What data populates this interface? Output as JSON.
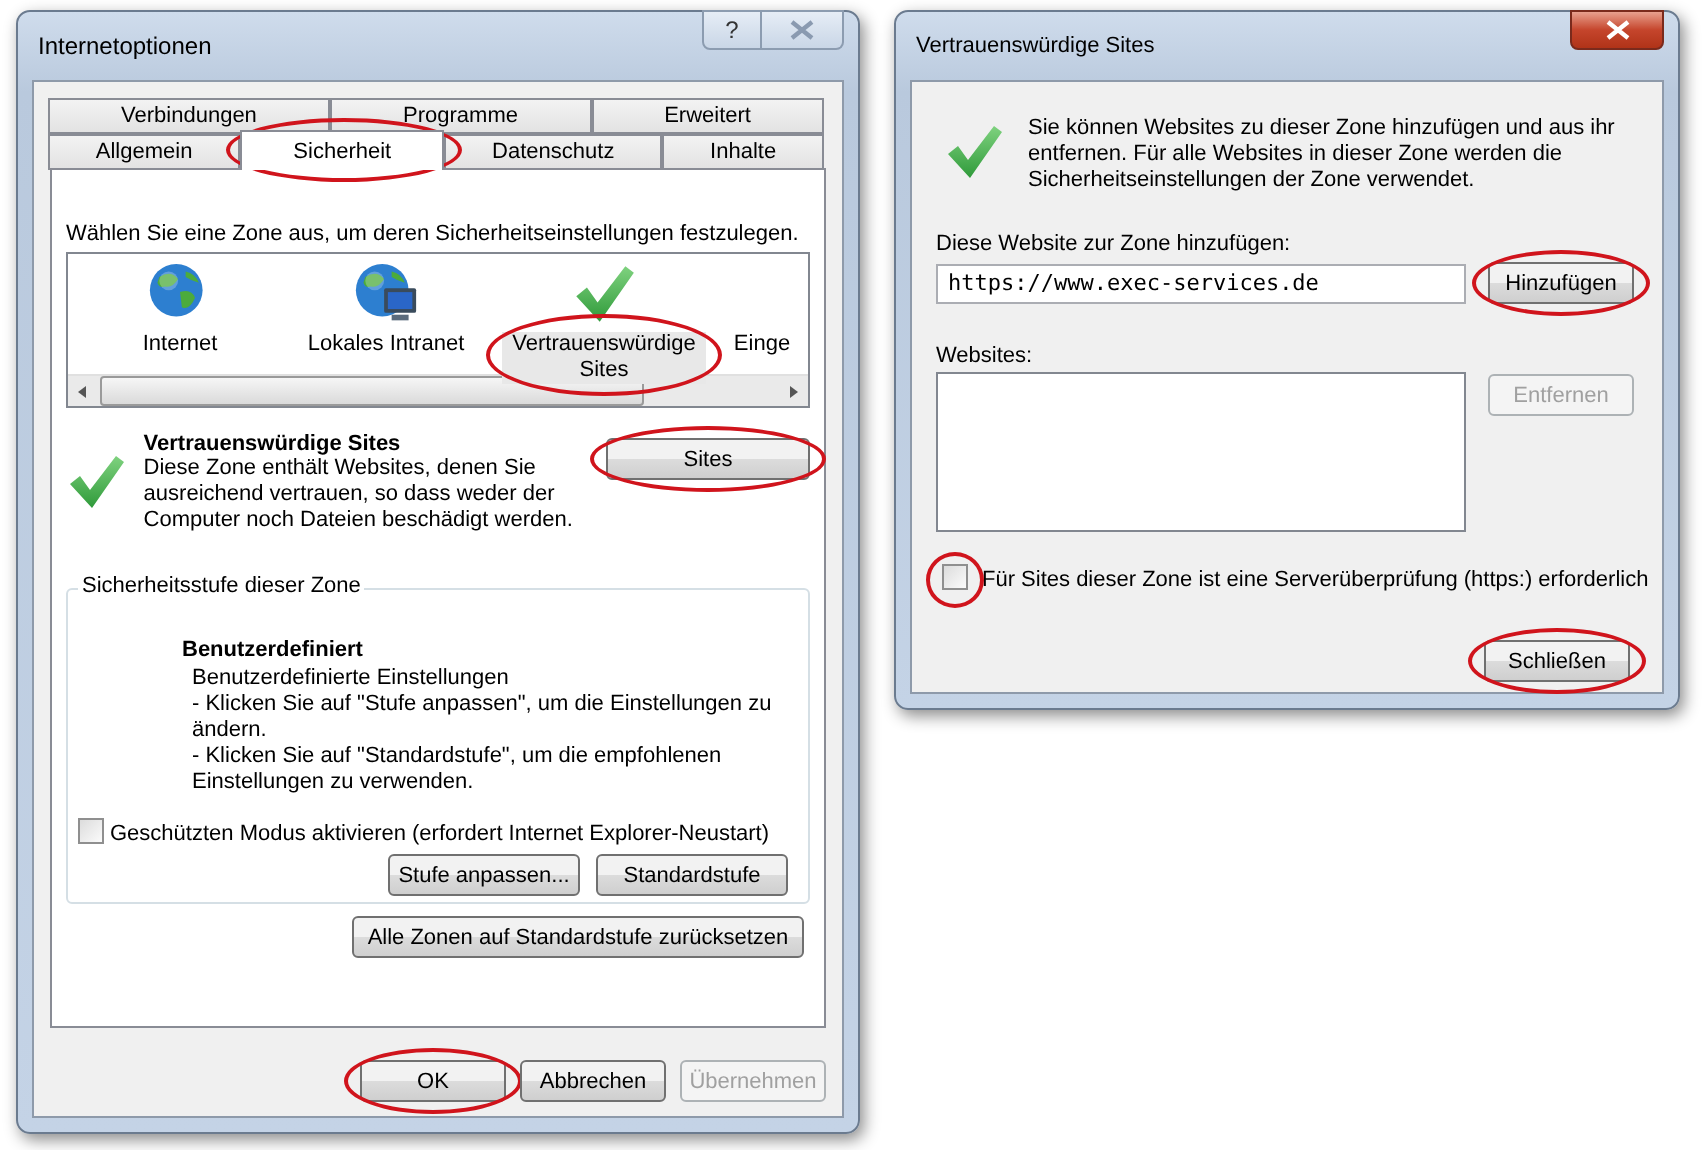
{
  "internet_options": {
    "title": "Internetoptionen",
    "help": "?",
    "tab_rows": [
      [
        {
          "label": "Verbindungen",
          "selected": false,
          "highlighted": false
        },
        {
          "label": "Programme",
          "selected": false,
          "highlighted": false
        },
        {
          "label": "Erweitert",
          "selected": false,
          "highlighted": false
        }
      ],
      [
        {
          "label": "Allgemein",
          "selected": false,
          "highlighted": false
        },
        {
          "label": "Sicherheit",
          "selected": true,
          "highlighted": true
        },
        {
          "label": "Datenschutz",
          "selected": false,
          "highlighted": false
        },
        {
          "label": "Inhalte",
          "selected": false,
          "highlighted": false
        }
      ]
    ],
    "zone_prompt": "Wählen Sie eine Zone aus, um deren Sicherheitseinstellungen festzulegen.",
    "zones": [
      {
        "label": "Internet",
        "kind": "globe",
        "selected": false,
        "highlighted": false
      },
      {
        "label": "Lokales Intranet",
        "kind": "intranet",
        "selected": false,
        "highlighted": false
      },
      {
        "label": "Vertrauenswürdige Sites",
        "kind": "check",
        "selected": true,
        "highlighted": true
      },
      {
        "label": "Einge",
        "kind": "partial",
        "selected": false,
        "highlighted": false
      }
    ],
    "zone_info": {
      "title": "Vertrauenswürdige Sites",
      "description": "Diese Zone enthält Websites, denen Sie ausreichend vertrauen, so dass weder der Computer noch Dateien beschädigt werden.",
      "button": {
        "label": "Sites",
        "highlighted": true,
        "disabled": false
      }
    },
    "security_level": {
      "legend": "Sicherheitsstufe dieser Zone",
      "level_name": "Benutzerdefiniert",
      "lines": [
        "Benutzerdefinierte Einstellungen",
        "- Klicken Sie auf \"Stufe anpassen\", um die Einstellungen zu ändern.",
        "- Klicken Sie auf \"Standardstufe\", um die empfohlenen Einstellungen zu verwenden."
      ],
      "protected_mode": {
        "label": "Geschützten Modus aktivieren (erfordert Internet Explorer-Neustart)",
        "checked": false,
        "highlighted": false
      },
      "buttons": [
        {
          "label": "Stufe anpassen...",
          "highlighted": false,
          "disabled": false
        },
        {
          "label": "Standardstufe",
          "highlighted": false,
          "disabled": false
        }
      ]
    },
    "reset_button": {
      "label": "Alle Zonen auf Standardstufe zurücksetzen",
      "highlighted": false,
      "disabled": false
    },
    "footer_buttons": [
      {
        "label": "OK",
        "highlighted": true,
        "disabled": false
      },
      {
        "label": "Abbrechen",
        "highlighted": false,
        "disabled": false
      },
      {
        "label": "Übernehmen",
        "highlighted": false,
        "disabled": true
      }
    ]
  },
  "trusted_sites": {
    "title": "Vertrauenswürdige Sites",
    "intro": "Sie können Websites zu dieser Zone hinzufügen und aus ihr entfernen. Für alle Websites in dieser Zone werden die Sicherheitseinstellungen der Zone verwendet.",
    "add_label": "Diese Website zur Zone hinzufügen:",
    "url": "https://www.exec-services.de",
    "add_button": {
      "label": "Hinzufügen",
      "highlighted": true,
      "disabled": false
    },
    "websites_label": "Websites:",
    "remove_button": {
      "label": "Entfernen",
      "highlighted": false,
      "disabled": true
    },
    "https_check": {
      "label": "Für Sites dieser Zone ist eine Serverüberprüfung (https:) erforderlich",
      "checked": false,
      "highlighted": true
    },
    "close_button": {
      "label": "Schließen",
      "highlighted": true,
      "disabled": false
    }
  }
}
